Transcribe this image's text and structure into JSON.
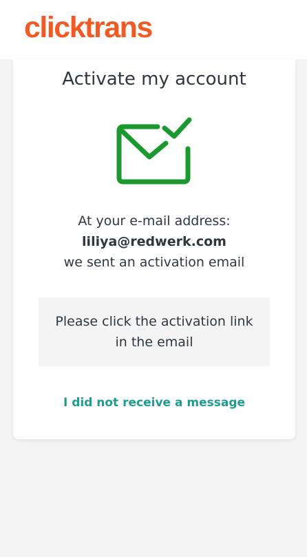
{
  "header": {
    "logo_text": "clicktrans",
    "logo_color": "#f05a24"
  },
  "card": {
    "title": "Activate my account",
    "icon": "envelope-check-icon",
    "icon_color": "#1a9a2e",
    "intro_line": "At your e-mail address:",
    "email": "liliya@redwerk.com",
    "sent_line": "we sent an activation email",
    "notice_text": "Please click the activation link in the email",
    "resend_link": "I did not receive a message",
    "link_color": "#1e9c8f"
  }
}
